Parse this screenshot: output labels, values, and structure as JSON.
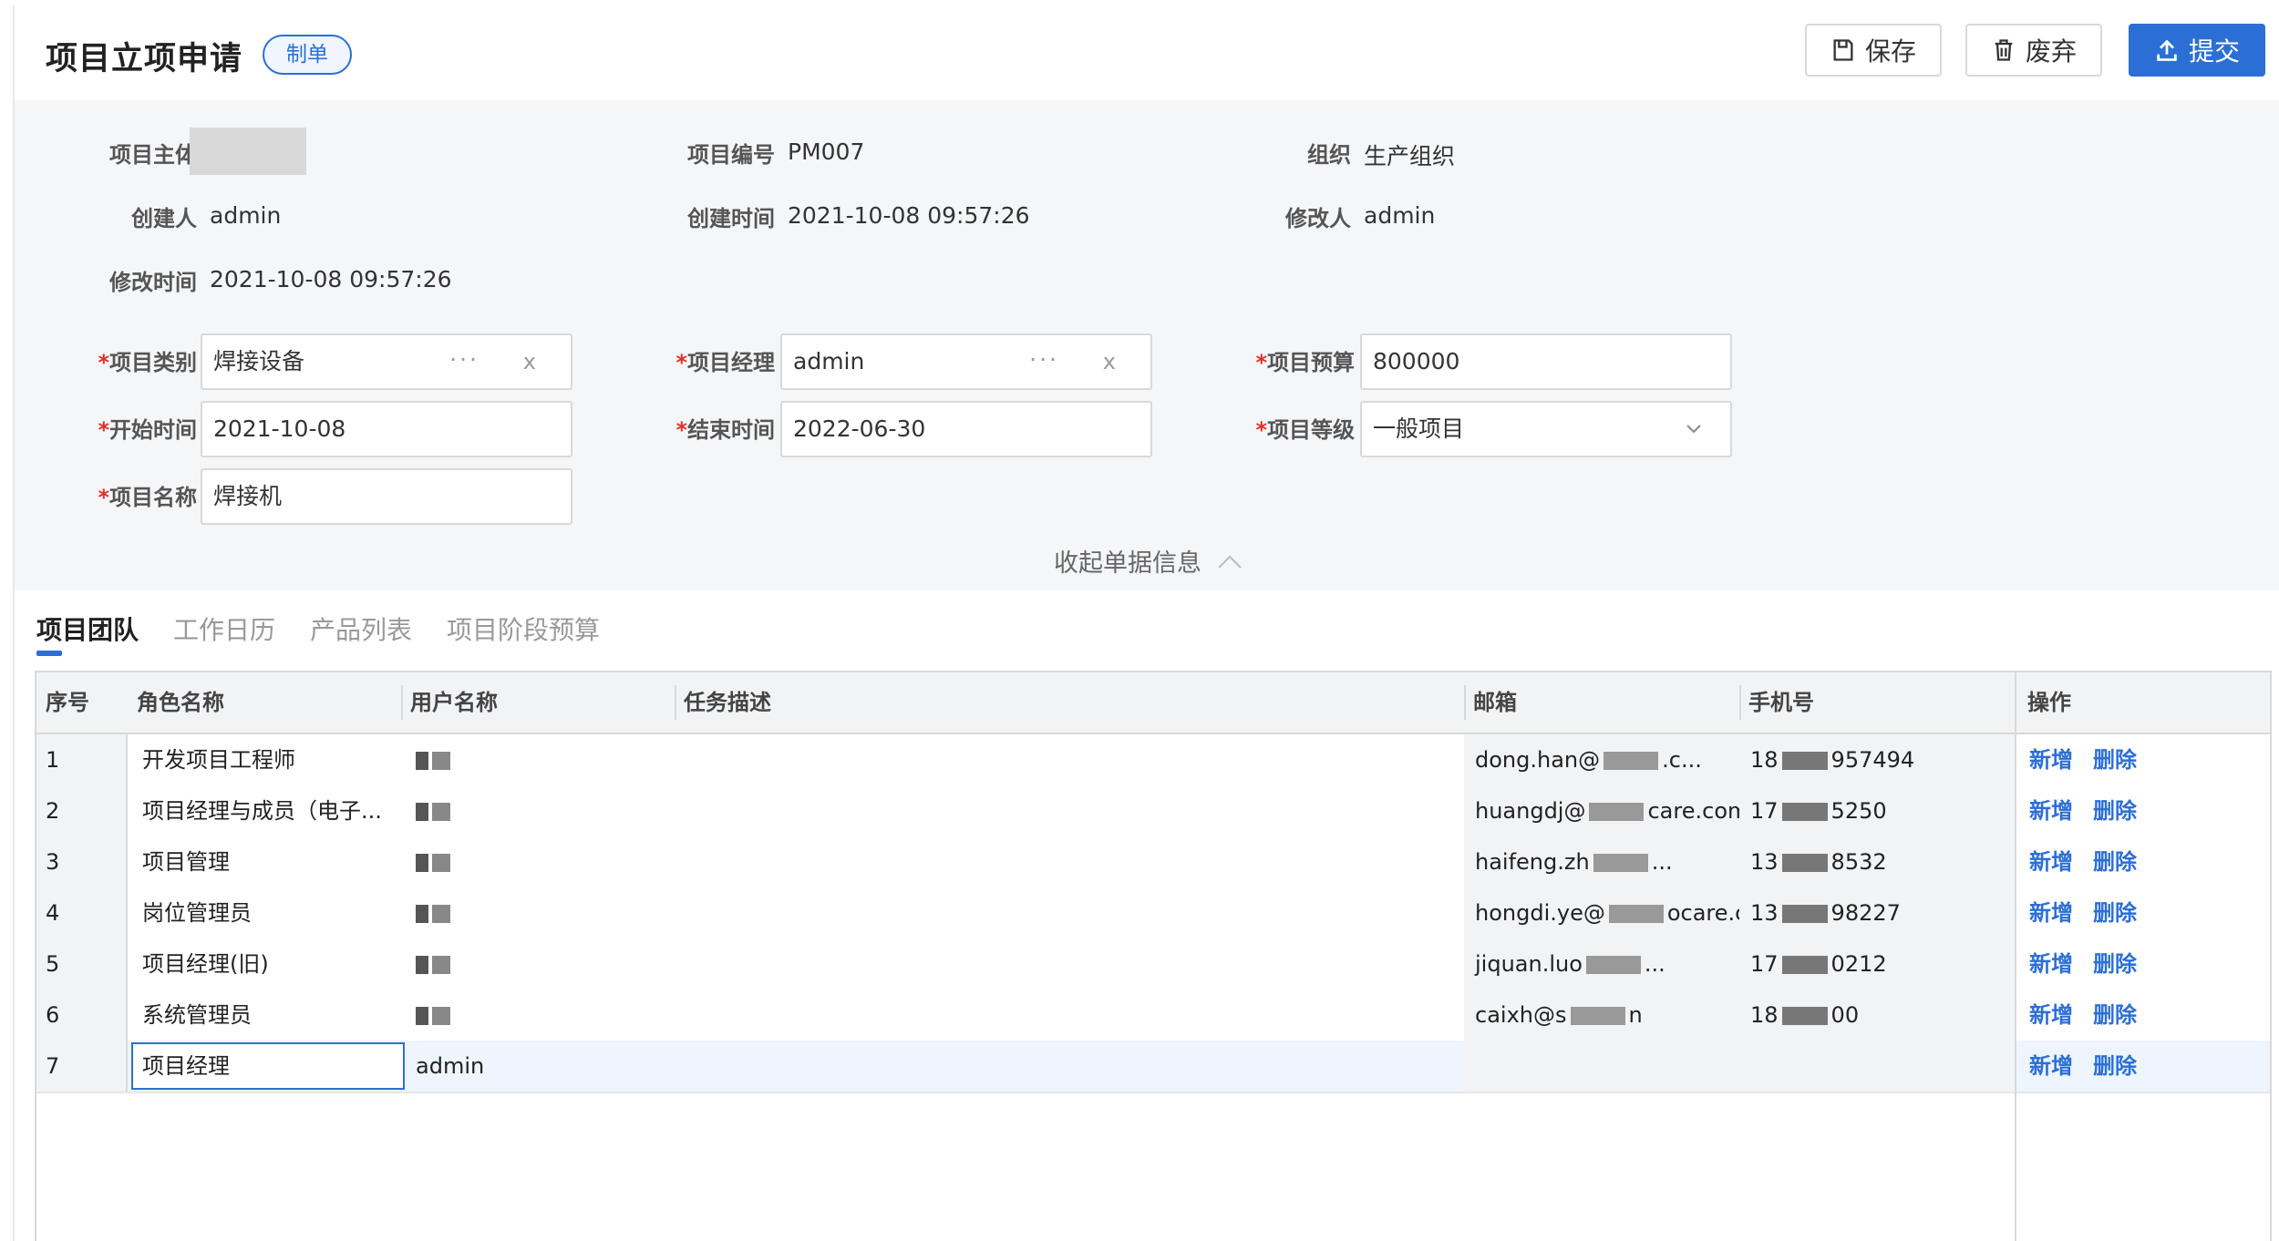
{
  "header": {
    "title": "项目立项申请",
    "status_badge": "制单",
    "save_label": "保存",
    "discard_label": "废弃",
    "submit_label": "提交"
  },
  "info": {
    "subject_label": "项目主体",
    "code_label": "项目编号",
    "code_value": "PM007",
    "org_label": "组织",
    "org_value": "生产组织",
    "creator_label": "创建人",
    "creator_value": "admin",
    "created_label": "创建时间",
    "created_value": "2021-10-08 09:57:26",
    "modifier_label": "修改人",
    "modifier_value": "admin",
    "modified_label": "修改时间",
    "modified_value": "2021-10-08 09:57:26"
  },
  "form": {
    "category_label": "项目类别",
    "category_value": "焊接设备",
    "manager_label": "项目经理",
    "manager_value": "admin",
    "budget_label": "项目预算",
    "budget_value": "800000",
    "start_label": "开始时间",
    "start_value": "2021-10-08",
    "end_label": "结束时间",
    "end_value": "2022-06-30",
    "level_label": "项目等级",
    "level_value": "一般项目",
    "name_label": "项目名称",
    "name_value": "焊接机",
    "required_mark": "*",
    "dots": "···",
    "clear": "x",
    "collapse_label": "收起单据信息"
  },
  "tabs": [
    "项目团队",
    "工作日历",
    "产品列表",
    "项目阶段预算"
  ],
  "table": {
    "headers": [
      "序号",
      "角色名称",
      "用户名称",
      "任务描述",
      "邮箱",
      "手机号",
      "操作"
    ],
    "rows": [
      {
        "idx": "1",
        "role": "开发项目工程师",
        "user": "",
        "email": "dong.han@",
        "email_tail": ".c...",
        "phone": "18",
        "phone_tail": "957494"
      },
      {
        "idx": "2",
        "role": "项目经理与成员（电子...",
        "user": "",
        "email": "huangdj@",
        "email_tail": "care.com",
        "phone": "17",
        "phone_tail": "5250"
      },
      {
        "idx": "3",
        "role": "项目管理",
        "user": "",
        "email": "haifeng.zh",
        "email_tail": "...",
        "phone": "13",
        "phone_tail": "8532"
      },
      {
        "idx": "4",
        "role": "岗位管理员",
        "user": "",
        "email": "hongdi.ye@",
        "email_tail": "ocare.c...",
        "phone": "13",
        "phone_tail": "98227"
      },
      {
        "idx": "5",
        "role": "项目经理(旧)",
        "user": "",
        "email": "jiquan.luo",
        "email_tail": "...",
        "phone": "17",
        "phone_tail": "0212"
      },
      {
        "idx": "6",
        "role": "系统管理员",
        "user": "",
        "email": "caixh@s",
        "email_tail": "n",
        "phone": "18",
        "phone_tail": "00"
      },
      {
        "idx": "7",
        "role": "项目经理",
        "user": "admin",
        "email": "",
        "email_tail": "",
        "phone": "",
        "phone_tail": ""
      }
    ],
    "add_label": "新增",
    "delete_label": "删除"
  }
}
